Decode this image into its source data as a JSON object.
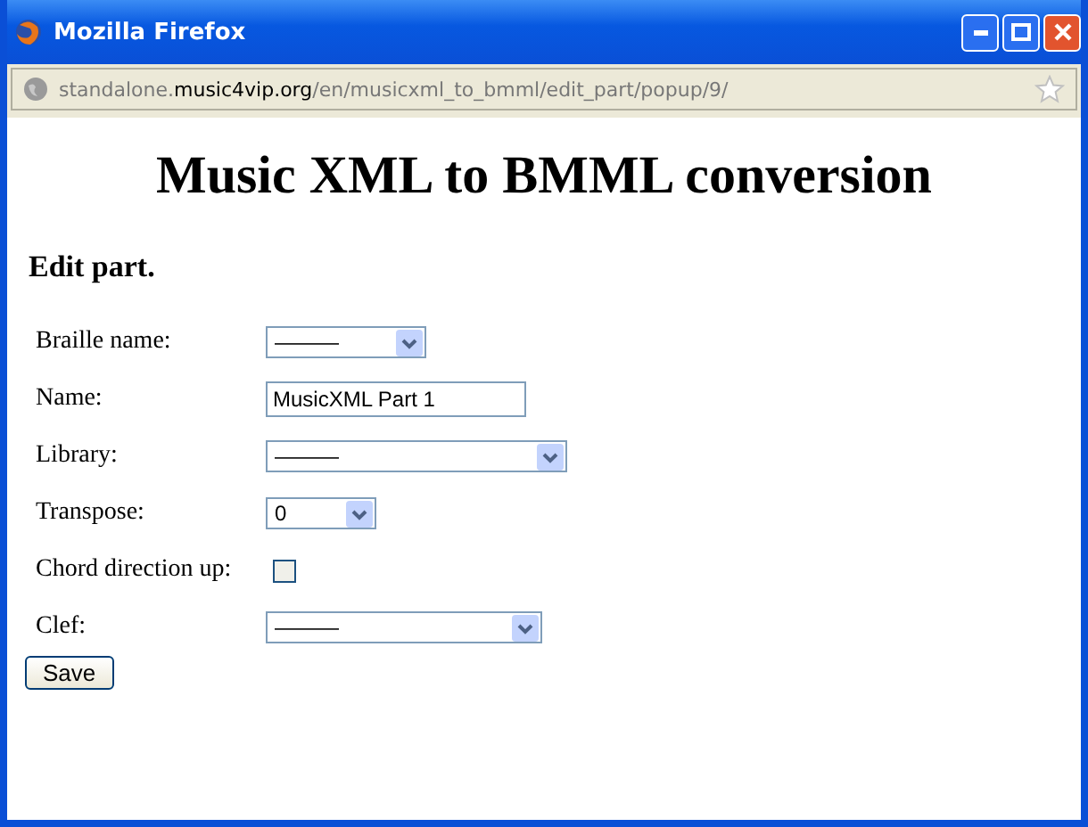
{
  "window": {
    "title": "Mozilla Firefox"
  },
  "address": {
    "subdomain": "standalone.",
    "domain": "music4vip.org",
    "path": "/en/musicxml_to_bmml/edit_part/popup/9/"
  },
  "heading": "Music XML to BMML conversion",
  "subheading": "Edit part.",
  "fields": [
    {
      "label": "Braille name:",
      "kind": "select",
      "value": "———"
    },
    {
      "label": "Name:",
      "kind": "text",
      "value": "MusicXML Part 1"
    },
    {
      "label": "Library:",
      "kind": "select",
      "value": "———"
    },
    {
      "label": "Transpose:",
      "kind": "select",
      "value": "0"
    },
    {
      "label": "Chord direction up:",
      "kind": "checkbox",
      "checked": false
    },
    {
      "label": "Clef:",
      "kind": "select",
      "value": "———"
    }
  ],
  "save_button": "Save"
}
